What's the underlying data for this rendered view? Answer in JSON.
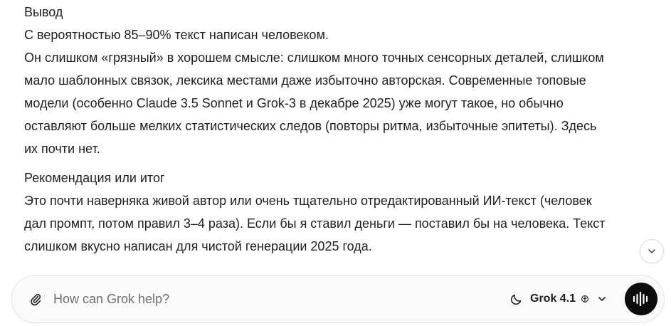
{
  "message": {
    "sections": [
      {
        "heading": "Вывод",
        "lines": [
          "С вероятностью 85–90% текст написан человеком.",
          "Он слишком «грязный» в хорошем смысле: слишком много точных сенсорных деталей, слишком",
          "мало шаблонных связок, лексика местами даже избыточно авторская. Современные топовые",
          "модели (особенно Claude 3.5 Sonnet и Grok-3 в декабре 2025) уже могут такое, но обычно",
          "оставляют больше мелких статистических следов (повторы ритма, избыточные эпитеты). Здесь",
          "их почти нет."
        ]
      },
      {
        "heading": "Рекомендация или итог",
        "lines": [
          "Это почти наверняка живой автор или очень тщательно отредактированный ИИ-текст (человек",
          "дал промпт, потом правил 3–4 раза). Если бы я ставил деньги — поставил бы на человека. Текст",
          "слишком вкусно написан для чистой генерации 2025 года."
        ]
      }
    ]
  },
  "composer": {
    "placeholder": "How can Grok help?",
    "attach_icon": "paperclip-icon",
    "mode_icon": "moon-icon",
    "model_label": "Grok 4.1",
    "model_badge_icon": "brain-icon",
    "dropdown_icon": "chevron-down-icon",
    "voice_icon": "voice-waveform-icon"
  },
  "scroll_button": {
    "icon": "chevron-down-icon"
  },
  "colors": {
    "text": "#1f1f1f",
    "placeholder": "#6f6f6f",
    "composer_bg": "#fafafa",
    "voice_button_bg": "#0d0d0d"
  }
}
